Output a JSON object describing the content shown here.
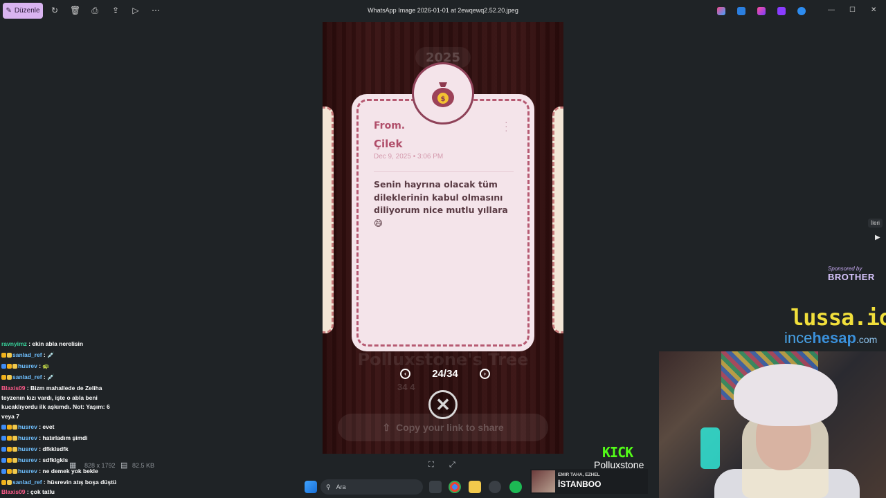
{
  "toolbar": {
    "edit_label": "Düzenle",
    "window_title": "WhatsApp Image 2026-01-01 at 2ewqewq2.52.20.jpeg",
    "minimize": "—",
    "maximize": "☐",
    "close": "✕"
  },
  "photo": {
    "year": "2025",
    "card": {
      "from_label": "From.",
      "sender": "Çilek",
      "date": "Dec 9, 2025 • 3:06 PM",
      "message": "Senin hayrına olacak tüm dileklerinin kabul olmasını diliyorum nice mutlu yıllara 😄"
    },
    "tree_title": "Polluxstone's Tree",
    "pager": "24/34",
    "stats": "34   4",
    "share_label": "Copy your link to share"
  },
  "viewer": {
    "next_tooltip": "İleri"
  },
  "overlay": {
    "sponsor_label": "Sponsored by",
    "sponsor_brand": "BROTHER",
    "lussa": "lussa.io",
    "ince": "ince",
    "hesap": "hesap",
    "com": ".com",
    "kick_logo": "KICK",
    "kick_user": "Polluxstone"
  },
  "chat": {
    "lines": [
      {
        "user": "ravnyimz",
        "text": " : ekin abla nerelisin"
      },
      {
        "user": "sanlad_ref",
        "text": " : 💉"
      },
      {
        "user": "husrev",
        "text": " : 🐢"
      },
      {
        "user": "sanlad_ref",
        "text": " : 💉"
      },
      {
        "user": "Blaxis09",
        "text": " : Bizm mahallede de Zeliha teyzenın kızı vardı, işte o abla beni kucaklıyordu ilk aşkımdı. Not: Yaşım: 6 veya 7"
      },
      {
        "user": "husrev",
        "text": " : evet"
      },
      {
        "user": "husrev",
        "text": " : hatırladım şimdi"
      },
      {
        "user": "husrev",
        "text": " : dfkklsdfk"
      },
      {
        "user": "husrev",
        "text": " : sdfklgkls"
      },
      {
        "user": "husrev",
        "text": " : ne demek yok bekle"
      },
      {
        "user": "sanlad_ref",
        "text": " : hüsrevin atış boşa düştü"
      },
      {
        "user": "Blaxis09",
        "text": " : çok tatlu"
      }
    ]
  },
  "info": {
    "dimensions": "828 x 1792",
    "file_size": "82.5 KB"
  },
  "taskbar": {
    "search_placeholder": "Ara"
  },
  "news": {
    "subtitle": "EMIR TAHA, EZHEL",
    "title": "İSTANBOO"
  }
}
